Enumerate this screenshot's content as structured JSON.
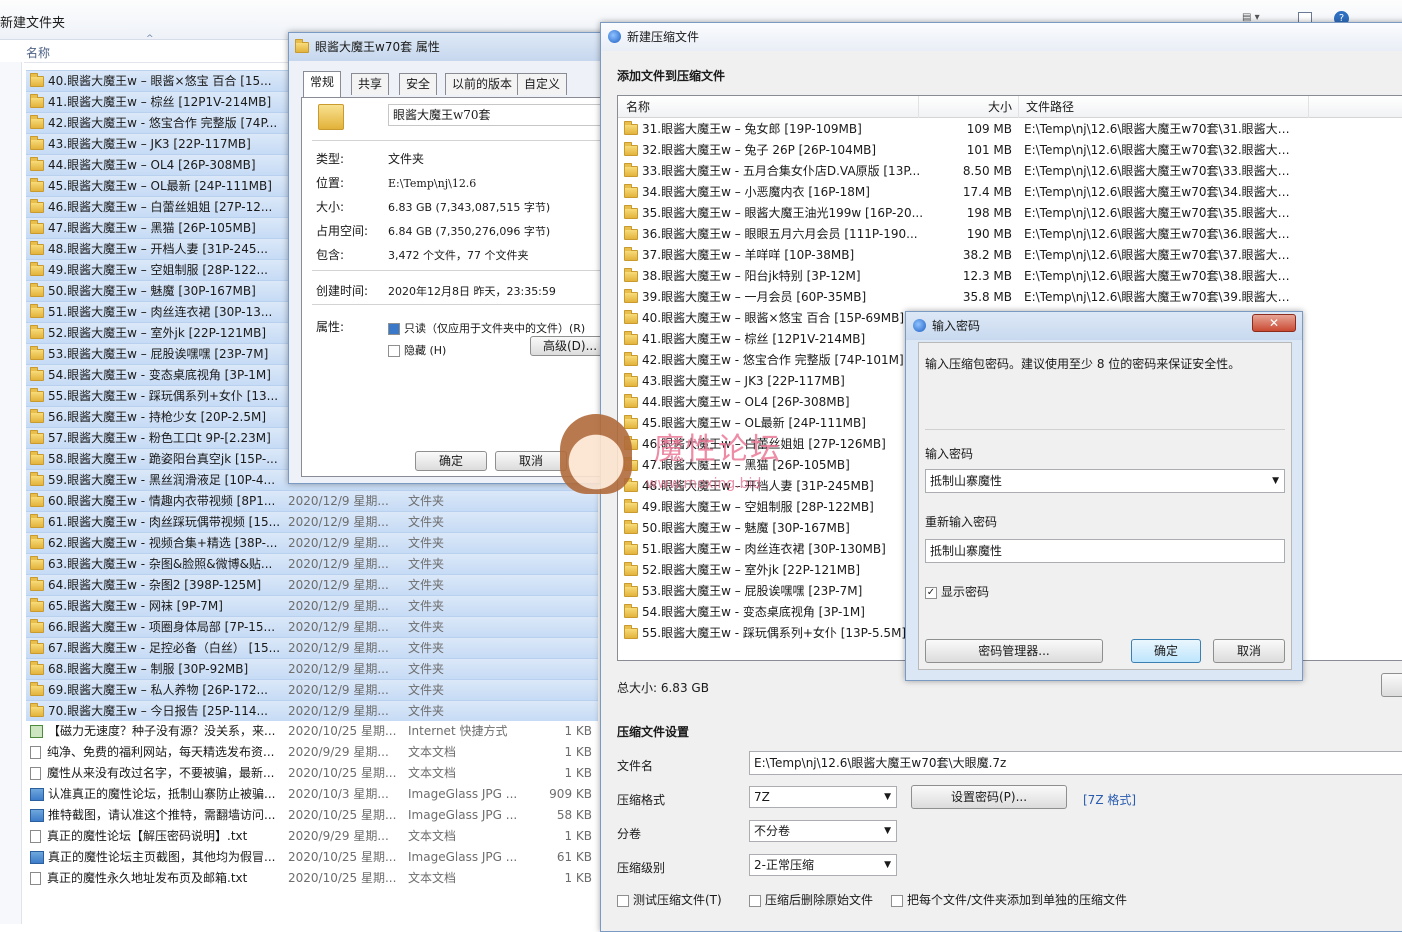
{
  "explorer": {
    "title": "新建文件夹",
    "column_name": "名称",
    "rows": [
      {
        "name": "40.眼酱大魔王w – 眼酱×悠宝 百合 [15...",
        "date": "",
        "type": "",
        "size": "",
        "icon": "folder"
      },
      {
        "name": "41.眼酱大魔王w – 棕丝 [12P1V-214MB]",
        "date": "",
        "type": "",
        "size": "",
        "icon": "folder"
      },
      {
        "name": "42.眼酱大魔王w - 悠宝合作 完整版 [74P...",
        "date": "",
        "type": "",
        "size": "",
        "icon": "folder"
      },
      {
        "name": "43.眼酱大魔王w – JK3 [22P-117MB]",
        "date": "",
        "type": "",
        "size": "",
        "icon": "folder"
      },
      {
        "name": "44.眼酱大魔王w – OL4 [26P-308MB]",
        "date": "",
        "type": "",
        "size": "",
        "icon": "folder"
      },
      {
        "name": "45.眼酱大魔王w – OL最新 [24P-111MB]",
        "date": "",
        "type": "",
        "size": "",
        "icon": "folder"
      },
      {
        "name": "46.眼酱大魔王w – 白蕾丝姐姐 [27P-12...",
        "date": "",
        "type": "",
        "size": "",
        "icon": "folder"
      },
      {
        "name": "47.眼酱大魔王w – 黑猫 [26P-105MB]",
        "date": "",
        "type": "",
        "size": "",
        "icon": "folder"
      },
      {
        "name": "48.眼酱大魔王w – 开档人妻 [31P-245...",
        "date": "",
        "type": "",
        "size": "",
        "icon": "folder"
      },
      {
        "name": "49.眼酱大魔王w – 空姐制服 [28P-122...",
        "date": "",
        "type": "",
        "size": "",
        "icon": "folder"
      },
      {
        "name": "50.眼酱大魔王w – 魅魔 [30P-167MB]",
        "date": "",
        "type": "",
        "size": "",
        "icon": "folder"
      },
      {
        "name": "51.眼酱大魔王w – 肉丝连衣裙 [30P-13...",
        "date": "",
        "type": "",
        "size": "",
        "icon": "folder"
      },
      {
        "name": "52.眼酱大魔王w – 室外jk [22P-121MB]",
        "date": "",
        "type": "",
        "size": "",
        "icon": "folder"
      },
      {
        "name": "53.眼酱大魔王w – 屁股诶嘿嘿 [23P-7M]",
        "date": "",
        "type": "",
        "size": "",
        "icon": "folder"
      },
      {
        "name": "54.眼酱大魔王w - 变态桌底视角 [3P-1M]",
        "date": "",
        "type": "",
        "size": "",
        "icon": "folder"
      },
      {
        "name": "55.眼酱大魔王w - 踩玩偶系列+女仆 [13...",
        "date": "",
        "type": "",
        "size": "",
        "icon": "folder"
      },
      {
        "name": "56.眼酱大魔王w - 持枪少女 [20P-2.5M]",
        "date": "",
        "type": "",
        "size": "",
        "icon": "folder"
      },
      {
        "name": "57.眼酱大魔王w - 粉色工口t 9P-[2.23M]",
        "date": "",
        "type": "",
        "size": "",
        "icon": "folder"
      },
      {
        "name": "58.眼酱大魔王w - 跪姿阳台真空jk [15P-...",
        "date": "",
        "type": "",
        "size": "",
        "icon": "folder"
      },
      {
        "name": "59.眼酱大魔王w - 黑丝润滑液足 [10P-4...",
        "date": "",
        "type": "",
        "size": "",
        "icon": "folder"
      },
      {
        "name": "60.眼酱大魔王w - 情趣内衣带视频 [8P1...",
        "date": "2020/12/9 星期...",
        "type": "文件夹",
        "size": "",
        "icon": "folder"
      },
      {
        "name": "61.眼酱大魔王w - 肉丝踩玩偶带视频 [15...",
        "date": "2020/12/9 星期...",
        "type": "文件夹",
        "size": "",
        "icon": "folder"
      },
      {
        "name": "62.眼酱大魔王w - 视频合集+精选 [38P-...",
        "date": "2020/12/9 星期...",
        "type": "文件夹",
        "size": "",
        "icon": "folder"
      },
      {
        "name": "63.眼酱大魔王w - 杂图&脸照&微博&贴...",
        "date": "2020/12/9 星期...",
        "type": "文件夹",
        "size": "",
        "icon": "folder"
      },
      {
        "name": "64.眼酱大魔王w - 杂图2 [398P-125M]",
        "date": "2020/12/9 星期...",
        "type": "文件夹",
        "size": "",
        "icon": "folder"
      },
      {
        "name": "65.眼酱大魔王w - 网袜 [9P-7M]",
        "date": "2020/12/9 星期...",
        "type": "文件夹",
        "size": "",
        "icon": "folder"
      },
      {
        "name": "66.眼酱大魔王w - 项圈身体局部 [7P-15...",
        "date": "2020/12/9 星期...",
        "type": "文件夹",
        "size": "",
        "icon": "folder"
      },
      {
        "name": "67.眼酱大魔王w - 足控必备（白丝） [15...",
        "date": "2020/12/9 星期...",
        "type": "文件夹",
        "size": "",
        "icon": "folder"
      },
      {
        "name": "68.眼酱大魔王w – 制服 [30P-92MB]",
        "date": "2020/12/9 星期...",
        "type": "文件夹",
        "size": "",
        "icon": "folder"
      },
      {
        "name": "69.眼酱大魔王w – 私人养物 [26P-172...",
        "date": "2020/12/9 星期...",
        "type": "文件夹",
        "size": "",
        "icon": "folder"
      },
      {
        "name": "70.眼酱大魔王w – 今日报告 [25P-114...",
        "date": "2020/12/9 星期...",
        "type": "文件夹",
        "size": "",
        "icon": "folder"
      },
      {
        "name": "【磁力无速度？种子没有源？没关系，来...",
        "date": "2020/10/25 星期...",
        "type": "Internet 快捷方式",
        "size": "1 KB",
        "icon": "link"
      },
      {
        "name": "纯净、免费的福利网站，每天精选发布资...",
        "date": "2020/9/29 星期...",
        "type": "文本文档",
        "size": "1 KB",
        "icon": "doc"
      },
      {
        "name": "魔性从来没有改过名字，不要被骗，最新...",
        "date": "2020/10/25 星期...",
        "type": "文本文档",
        "size": "1 KB",
        "icon": "doc"
      },
      {
        "name": "认准真正的魔性论坛，抵制山寨防止被骗...",
        "date": "2020/10/3 星期...",
        "type": "ImageGlass JPG ...",
        "size": "909 KB",
        "icon": "jpg"
      },
      {
        "name": "推特截图，请认准这个推特，需翻墙访问...",
        "date": "2020/10/25 星期...",
        "type": "ImageGlass JPG ...",
        "size": "58 KB",
        "icon": "jpg"
      },
      {
        "name": "真正的魔性论坛【解压密码说明】.txt",
        "date": "2020/9/29 星期...",
        "type": "文本文档",
        "size": "1 KB",
        "icon": "doc"
      },
      {
        "name": "真正的魔性论坛主页截图，其他均为假冒...",
        "date": "2020/10/25 星期...",
        "type": "ImageGlass JPG ...",
        "size": "61 KB",
        "icon": "jpg"
      },
      {
        "name": "真正的魔性永久地址发布页及邮箱.txt",
        "date": "2020/10/25 星期...",
        "type": "文本文档",
        "size": "1 KB",
        "icon": "doc"
      }
    ]
  },
  "properties": {
    "title": "眼酱大魔王w70套 属性",
    "tabs": [
      "常规",
      "共享",
      "安全",
      "以前的版本",
      "自定义"
    ],
    "folder_name": "眼酱大魔王w70套",
    "type_label": "类型:",
    "type_value": "文件夹",
    "location_label": "位置:",
    "location_value": "E:\\Temp\\nj\\12.6",
    "size_label": "大小:",
    "size_value": "6.83 GB (7,343,087,515 字节)",
    "disk_label": "占用空间:",
    "disk_value": "6.84 GB (7,350,276,096 字节)",
    "contains_label": "包含:",
    "contains_value": "3,472 个文件，77 个文件夹",
    "created_label": "创建时间:",
    "created_value": "2020年12月8日 昨天，23:35:59",
    "attr_label": "属性:",
    "readonly_label": "只读（仅应用于文件夹中的文件）(R)",
    "hidden_label": "隐藏 (H)",
    "advanced_label": "高级(D)...",
    "ok_label": "确定",
    "cancel_label": "取消"
  },
  "archive": {
    "title": "新建压缩文件",
    "section_add": "添加文件到压缩文件",
    "col_name": "名称",
    "col_size": "大小",
    "col_path": "文件路径",
    "rows": [
      {
        "name": "31.眼酱大魔王w – 兔女郎 [19P-109MB]",
        "size": "109 MB",
        "path": "E:\\Temp\\nj\\12.6\\眼酱大魔王w70套\\31.眼酱大魔..."
      },
      {
        "name": "32.眼酱大魔王w – 兔子 26P [26P-104MB]",
        "size": "101 MB",
        "path": "E:\\Temp\\nj\\12.6\\眼酱大魔王w70套\\32.眼酱大魔..."
      },
      {
        "name": "33.眼酱大魔王w - 五月合集女仆店D.VA原版 [13P...",
        "size": "8.50 MB",
        "path": "E:\\Temp\\nj\\12.6\\眼酱大魔王w70套\\33.眼酱大魔..."
      },
      {
        "name": "34.眼酱大魔王w – 小恶魔内衣 [16P-18M]",
        "size": "17.4 MB",
        "path": "E:\\Temp\\nj\\12.6\\眼酱大魔王w70套\\34.眼酱大魔..."
      },
      {
        "name": "35.眼酱大魔王w – 眼酱大魔王油光199w [16P-20...",
        "size": "198 MB",
        "path": "E:\\Temp\\nj\\12.6\\眼酱大魔王w70套\\35.眼酱大魔..."
      },
      {
        "name": "36.眼酱大魔王w – 眼眼五月六月会员 [111P-190...",
        "size": "190 MB",
        "path": "E:\\Temp\\nj\\12.6\\眼酱大魔王w70套\\36.眼酱大魔..."
      },
      {
        "name": "37.眼酱大魔王w – 羊咩咩 [10P-38MB]",
        "size": "38.2 MB",
        "path": "E:\\Temp\\nj\\12.6\\眼酱大魔王w70套\\37.眼酱大魔..."
      },
      {
        "name": "38.眼酱大魔王w – 阳台jk特别 [3P-12M]",
        "size": "12.3 MB",
        "path": "E:\\Temp\\nj\\12.6\\眼酱大魔王w70套\\38.眼酱大魔..."
      },
      {
        "name": "39.眼酱大魔王w – 一月会员 [60P-35MB]",
        "size": "35.8 MB",
        "path": "E:\\Temp\\nj\\12.6\\眼酱大魔王w70套\\39.眼酱大魔..."
      },
      {
        "name": "40.眼酱大魔王w – 眼酱×悠宝 百合 [15P-69MB]",
        "size": "",
        "path": ""
      },
      {
        "name": "41.眼酱大魔王w – 棕丝 [12P1V-214MB]",
        "size": "",
        "path": ""
      },
      {
        "name": "42.眼酱大魔王w - 悠宝合作 完整版 [74P-101M]",
        "size": "",
        "path": ""
      },
      {
        "name": "43.眼酱大魔王w – JK3 [22P-117MB]",
        "size": "",
        "path": ""
      },
      {
        "name": "44.眼酱大魔王w – OL4 [26P-308MB]",
        "size": "",
        "path": ""
      },
      {
        "name": "45.眼酱大魔王w – OL最新 [24P-111MB]",
        "size": "",
        "path": ""
      },
      {
        "name": "46.眼酱大魔王w – 白蕾丝姐姐 [27P-126MB]",
        "size": "",
        "path": ""
      },
      {
        "name": "47.眼酱大魔王w – 黑猫 [26P-105MB]",
        "size": "",
        "path": ""
      },
      {
        "name": "48.眼酱大魔王w – 开档人妻 [31P-245MB]",
        "size": "",
        "path": ""
      },
      {
        "name": "49.眼酱大魔王w – 空姐制服 [28P-122MB]",
        "size": "",
        "path": ""
      },
      {
        "name": "50.眼酱大魔王w – 魅魔 [30P-167MB]",
        "size": "",
        "path": ""
      },
      {
        "name": "51.眼酱大魔王w – 肉丝连衣裙 [30P-130MB]",
        "size": "",
        "path": ""
      },
      {
        "name": "52.眼酱大魔王w – 室外jk [22P-121MB]",
        "size": "",
        "path": ""
      },
      {
        "name": "53.眼酱大魔王w – 屁股诶嘿嘿 [23P-7M]",
        "size": "",
        "path": ""
      },
      {
        "name": "54.眼酱大魔王w - 变态桌底视角 [3P-1M]",
        "size": "",
        "path": ""
      },
      {
        "name": "55.眼酱大魔王w - 踩玩偶系列+女仆 [13P-5.5M]",
        "size": "",
        "path": ""
      }
    ],
    "total_size": "总大小: 6.83 GB",
    "settings_title": "压缩文件设置",
    "filename_label": "文件名",
    "filename_value": "E:\\Temp\\nj\\12.6\\眼酱大魔王w70套\\大眼魔.7z",
    "format_label": "压缩格式",
    "format_value": "7Z",
    "set_password_label": "设置密码(P)...",
    "format_link": "[7Z 格式]",
    "volume_label": "分卷",
    "volume_value": "不分卷",
    "level_label": "压缩级别",
    "level_value": "2-正常压缩",
    "opt_test": "测试压缩文件(T)",
    "opt_delete": "压缩后删除原始文件",
    "opt_separate": "把每个文件/文件夹添加到单独的压缩文件"
  },
  "password": {
    "title": "输入密码",
    "hint": "输入压缩包密码。建议使用至少 8 位的密码来保证安全性。",
    "enter_label": "输入密码",
    "enter_value": "抵制山寨魔性",
    "reenter_label": "重新输入密码",
    "reenter_value": "抵制山寨魔性",
    "show_label": "显示密码",
    "manager_label": "密码管理器...",
    "ok_label": "确定",
    "cancel_label": "取消"
  },
  "watermark": {
    "title": "魔性论坛",
    "url": "www.moxing.bid"
  }
}
